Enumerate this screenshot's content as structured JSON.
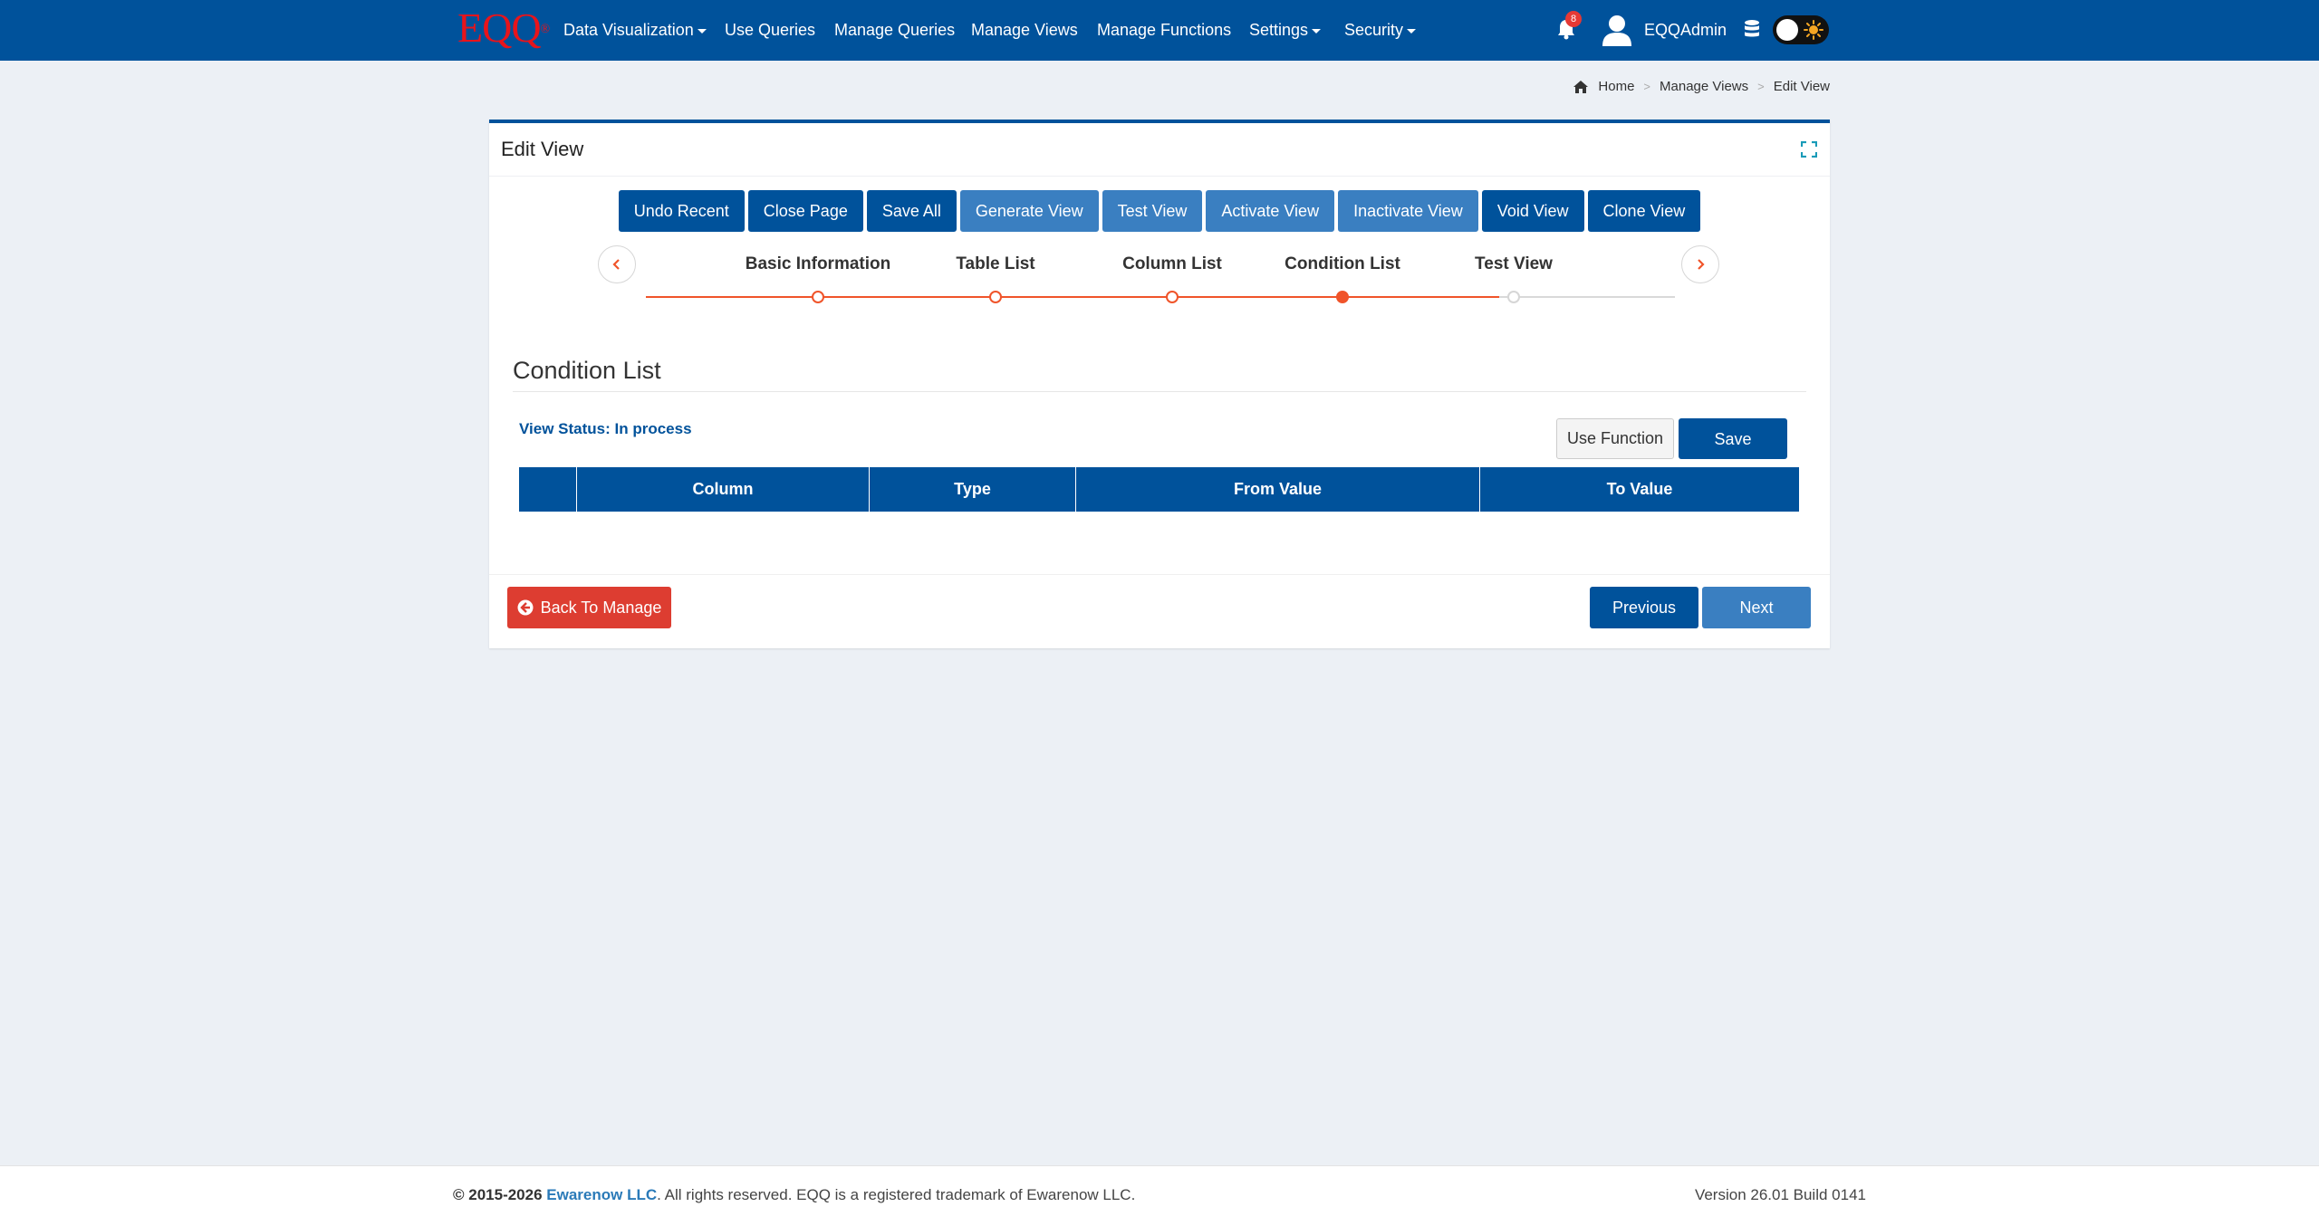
{
  "navbar": {
    "logo_text": "EQQ",
    "logo_mark": "®",
    "items": [
      {
        "label": "Data Visualization",
        "dropdown": true
      },
      {
        "label": "Use Queries",
        "dropdown": false
      },
      {
        "label": "Manage Queries",
        "dropdown": false
      },
      {
        "label": "Manage Views",
        "dropdown": false
      },
      {
        "label": "Manage Functions",
        "dropdown": false
      },
      {
        "label": "Settings",
        "dropdown": true
      },
      {
        "label": "Security",
        "dropdown": true
      }
    ],
    "notification_count": "8",
    "username": "EQQAdmin",
    "brand_color": "#00529b",
    "logo_color": "#e8141b"
  },
  "breadcrumb": {
    "items": [
      "Home",
      "Manage Views",
      "Edit View"
    ]
  },
  "panel": {
    "title": "Edit View",
    "toolbar": [
      {
        "label": "Undo Recent",
        "style": "dark"
      },
      {
        "label": "Close Page",
        "style": "dark"
      },
      {
        "label": "Save All",
        "style": "dark"
      },
      {
        "label": "Generate View",
        "style": "light"
      },
      {
        "label": "Test View",
        "style": "light"
      },
      {
        "label": "Activate View",
        "style": "light"
      },
      {
        "label": "Inactivate View",
        "style": "light"
      },
      {
        "label": "Void View",
        "style": "dark"
      },
      {
        "label": "Clone View",
        "style": "dark"
      }
    ],
    "steps": [
      {
        "label": "Basic Information",
        "state": "done"
      },
      {
        "label": "Table List",
        "state": "done"
      },
      {
        "label": "Column List",
        "state": "done"
      },
      {
        "label": "Condition List",
        "state": "active"
      },
      {
        "label": "Test View",
        "state": "todo"
      }
    ],
    "section_title": "Condition List",
    "view_status": "View Status: In process",
    "use_function_label": "Use Function",
    "save_label": "Save",
    "table_headers": [
      "",
      "Column",
      "Type",
      "From Value",
      "To Value"
    ],
    "back_label": "Back To Manage",
    "previous_label": "Previous",
    "next_label": "Next",
    "step_accent": "#f0542a"
  },
  "footer": {
    "copyright": "© 2015-2026",
    "company": "Ewarenow LLC",
    "rights": ". All rights reserved. EQQ is a registered trademark of Ewarenow LLC.",
    "version": "Version 26.01 Build 0141"
  }
}
